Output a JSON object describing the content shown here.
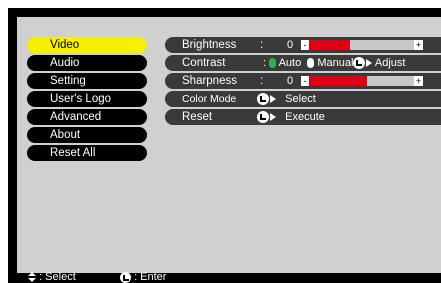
{
  "menu": {
    "items": [
      {
        "label": "Video"
      },
      {
        "label": "Audio"
      },
      {
        "label": "Setting"
      },
      {
        "label": "User's Logo"
      },
      {
        "label": "Advanced"
      },
      {
        "label": "About"
      },
      {
        "label": "Reset All"
      }
    ],
    "selected_index": 0
  },
  "settings": {
    "brightness": {
      "label": "Brightness",
      "colon": ":",
      "value": "0",
      "level_percent": 40
    },
    "contrast": {
      "label": "Contrast",
      "colon": ":",
      "auto_label": "Auto",
      "manual_label": "Manual",
      "adjust_label": "Adjust",
      "selected_mode": "Auto"
    },
    "sharpness": {
      "label": "Sharpness",
      "colon": ":",
      "value": "0",
      "level_percent": 54
    },
    "color_mode": {
      "label": "Color Mode",
      "action_label": "Select"
    },
    "reset": {
      "label": "Reset",
      "action_label": "Execute"
    }
  },
  "slider_glyphs": {
    "minus": "-",
    "plus": "+"
  },
  "footer": {
    "select_hint": ": Select",
    "enter_hint": ": Enter"
  },
  "colors": {
    "selected_menu": "#f6f000",
    "slider_fill": "#e00014",
    "mode_auto": "#2db34a",
    "mode_manual": "#ffffff",
    "panel": "#d0d0d0",
    "row_bg": "#3a3a3a"
  }
}
